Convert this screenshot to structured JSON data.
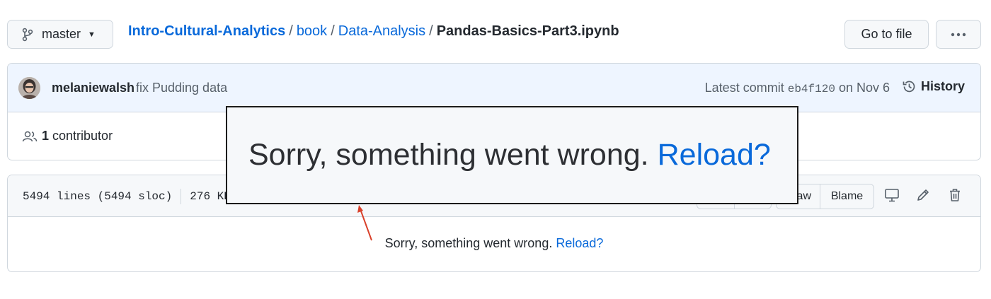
{
  "branch": {
    "name": "master"
  },
  "breadcrumb": {
    "repo": "Intro-Cultural-Analytics",
    "sep": "/",
    "parts": [
      "book",
      "Data-Analysis"
    ],
    "current": "Pandas-Basics-Part3.ipynb"
  },
  "toolbar": {
    "goto_label": "Go to file",
    "more_icon": "kebab-horizontal-icon"
  },
  "commit": {
    "author": "melaniewalsh",
    "message": "fix Pudding data",
    "latest_prefix": "Latest commit",
    "sha": "eb4f120",
    "date_text": "on Nov 6",
    "history_label": "History"
  },
  "contributors": {
    "count": "1",
    "label": "contributor"
  },
  "file": {
    "lines": "5494 lines (5494 sloc)",
    "size": "276 KB",
    "raw_label": "Raw",
    "blame_label": "Blame",
    "error_text": "Sorry, something went wrong.",
    "reload_label": "Reload?"
  },
  "overlay": {
    "error_text": "Sorry, something went wrong.",
    "reload_label": "Reload?"
  },
  "colors": {
    "accent": "#0969da",
    "annotation_arrow": "#d9412b",
    "commit_bar_bg": "#eef5ff"
  }
}
